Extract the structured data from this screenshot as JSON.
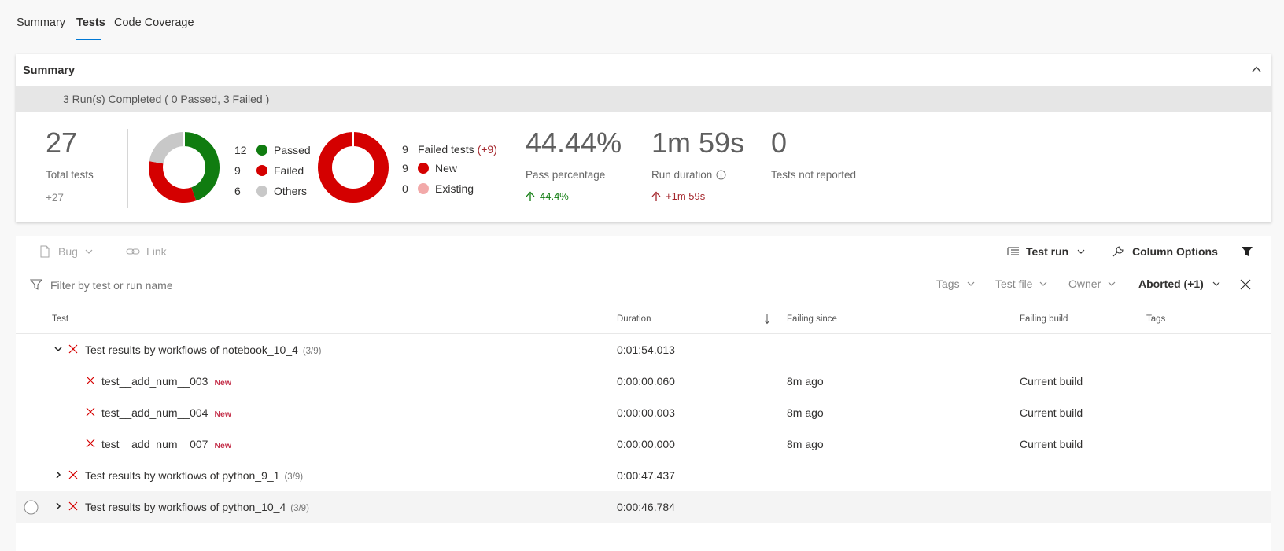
{
  "tabs": [
    {
      "label": "Summary"
    },
    {
      "label": "Tests"
    },
    {
      "label": "Code Coverage"
    }
  ],
  "summary": {
    "title": "Summary",
    "runs_completed": "3 Run(s) Completed ( 0 Passed, 3 Failed )",
    "total_tests": "27",
    "total_tests_label": "Total tests",
    "total_tests_delta": "+27",
    "outcome_legend": [
      {
        "count": "12",
        "label": "Passed",
        "color": "#107c10"
      },
      {
        "count": "9",
        "label": "Failed",
        "color": "#d40000"
      },
      {
        "count": "6",
        "label": "Others",
        "color": "#c8c8c8"
      }
    ],
    "outcome_values": {
      "passed": 12,
      "failed": 9,
      "others": 6
    },
    "failed_tests_count": "9",
    "failed_tests_label": "Failed tests",
    "failed_tests_delta": "(+9)",
    "failure_legend": [
      {
        "count": "9",
        "label": "New",
        "color": "#d40000"
      },
      {
        "count": "0",
        "label": "Existing",
        "color": "#f2a9a9"
      }
    ],
    "failure_values": {
      "new": 9,
      "existing": 0
    },
    "pass_percentage": "44.44%",
    "pass_percentage_label": "Pass percentage",
    "pass_percentage_delta": "44.4%",
    "run_duration": "1m 59s",
    "run_duration_label": "Run duration",
    "run_duration_delta": "+1m 59s",
    "not_reported": "0",
    "not_reported_label": "Tests not reported",
    "colors": {
      "green": "#107c10",
      "red": "#d40000",
      "delta_red": "#a4262c",
      "accent": "#0078d4"
    }
  },
  "toolbar": {
    "bug_label": "Bug",
    "link_label": "Link",
    "test_run_label": "Test run",
    "column_options_label": "Column Options"
  },
  "filters": {
    "search_placeholder": "Filter by test or run name",
    "tags_label": "Tags",
    "test_file_label": "Test file",
    "owner_label": "Owner",
    "outcome_label": "Aborted (+1)"
  },
  "table": {
    "headers": {
      "test": "Test",
      "duration": "Duration",
      "failing_since": "Failing since",
      "failing_build": "Failing build",
      "tags": "Tags"
    },
    "rows": [
      {
        "name": "Test results by workflows of notebook_10_4",
        "count": "(3/9)",
        "duration": "0:01:54.013",
        "failing_since": "",
        "failing_build": "",
        "badge": ""
      },
      {
        "name": "test__add_num__003",
        "count": "",
        "duration": "0:00:00.060",
        "failing_since": "8m ago",
        "failing_build": "Current build",
        "badge": "New"
      },
      {
        "name": "test__add_num__004",
        "count": "",
        "duration": "0:00:00.003",
        "failing_since": "8m ago",
        "failing_build": "Current build",
        "badge": "New"
      },
      {
        "name": "test__add_num__007",
        "count": "",
        "duration": "0:00:00.000",
        "failing_since": "8m ago",
        "failing_build": "Current build",
        "badge": "New"
      },
      {
        "name": "Test results by workflows of python_9_1",
        "count": "(3/9)",
        "duration": "0:00:47.437",
        "failing_since": "",
        "failing_build": "",
        "badge": ""
      },
      {
        "name": "Test results by workflows of python_10_4",
        "count": "(3/9)",
        "duration": "0:00:46.784",
        "failing_since": "",
        "failing_build": "",
        "badge": ""
      }
    ]
  }
}
